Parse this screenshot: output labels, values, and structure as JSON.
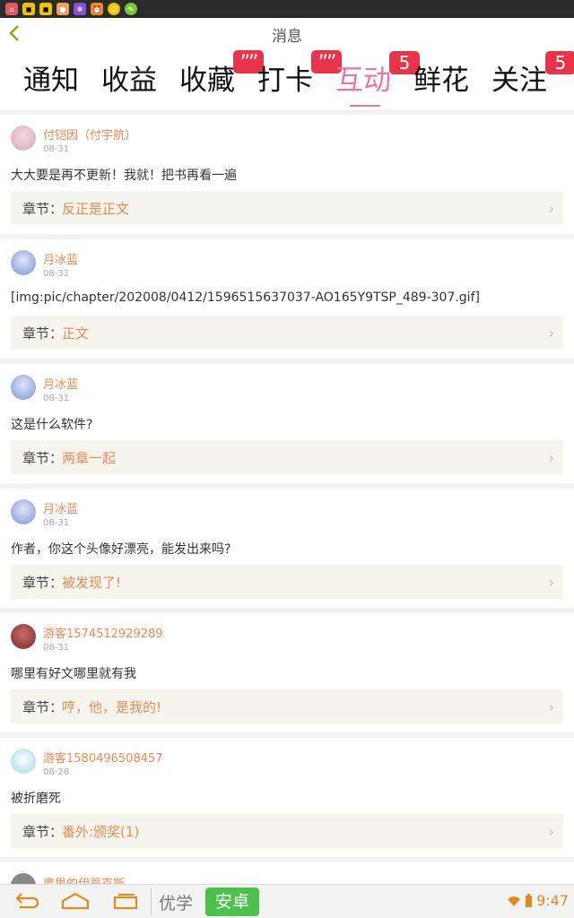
{
  "header": {
    "title": "消息"
  },
  "tabs": [
    {
      "label": "通知"
    },
    {
      "label": "收益"
    },
    {
      "label": "收藏",
      "badge": "””"
    },
    {
      "label": "打卡",
      "badge": "””"
    },
    {
      "label": "互动",
      "badge": "5",
      "active": true
    },
    {
      "label": "鲜花"
    },
    {
      "label": "关注",
      "badge": "5"
    }
  ],
  "chapter_label": "章节：",
  "messages": [
    {
      "user": "付铠因（付宇航）",
      "date": "08-31",
      "text": "大大要是再不更新！我就！把书再看一遍",
      "chapter": "反正是正文"
    },
    {
      "user": "月冰蓝",
      "date": "08-31",
      "text": "[img:pic/chapter/202008/0412/1596515637037-AO165Y9TSP_489-307.gif]",
      "chapter": "正文"
    },
    {
      "user": "月冰蓝",
      "date": "08-31",
      "text": "这是什么软件?",
      "chapter": "两章一起"
    },
    {
      "user": "月冰蓝",
      "date": "08-31",
      "text": "作者，你这个头像好漂亮，能发出来吗?",
      "chapter": "被发现了!"
    },
    {
      "user": "游客1574512929289",
      "date": "08-31",
      "text": "哪里有好文哪里就有我",
      "chapter": "哼，他，是我的!"
    },
    {
      "user": "游客1580496508457",
      "date": "08-28",
      "text": "被折磨死",
      "chapter": "番外:颁奖(1)"
    }
  ],
  "partial_user": "鹰里的伊蒂克斯",
  "ime": {
    "left_label": "优学",
    "active_label": "安卓"
  },
  "status": {
    "time": "9:47"
  },
  "colors": {
    "accent": "#e8789a",
    "username": "#ea8a58",
    "badge": "#e8344a",
    "ime_green": "#4cc24c"
  }
}
